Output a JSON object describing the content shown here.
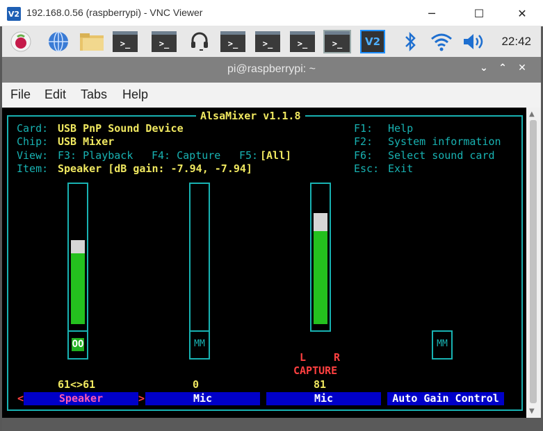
{
  "vnc": {
    "title": "192.168.0.56 (raspberrypi) - VNC Viewer",
    "logo": "V2",
    "minimize": "─",
    "maximize": "☐",
    "close": "✕"
  },
  "panel": {
    "clock": "22:42",
    "term_prompt": ">_",
    "vnc_icon": "V2",
    "icons": [
      "raspberry-menu-icon",
      "web-browser-icon",
      "file-manager-icon",
      "terminal-icon",
      "terminal-icon",
      "headset-icon",
      "terminal-icon",
      "terminal-icon",
      "terminal-icon",
      "terminal-icon",
      "vnc-server-icon",
      "bluetooth-icon",
      "wifi-icon",
      "volume-icon"
    ]
  },
  "terminal": {
    "title": "pi@raspberrypi: ~",
    "menu": [
      "File",
      "Edit",
      "Tabs",
      "Help"
    ],
    "btn_min": "⌄",
    "btn_max": "⌃",
    "btn_close": "✕"
  },
  "alsamixer": {
    "title": "AlsaMixer v1.1.8",
    "card_label": "Card:",
    "card_value": "USB PnP Sound Device",
    "chip_label": "Chip:",
    "chip_value": "USB Mixer",
    "view_label": "View:",
    "view_f3": "F3: Playback",
    "view_f4": "F4: Capture",
    "view_f5": "F5:",
    "view_all": "[All]",
    "item_label": "Item:",
    "item_value": "Speaker [dB gain: -7.94, -7.94]",
    "help_keys": [
      "F1:",
      "F2:",
      "F6:",
      "Esc:"
    ],
    "help_texts": [
      "Help",
      "System information",
      "Select sound card",
      "Exit"
    ],
    "controls": [
      {
        "name": "Speaker",
        "value_text": "61<>61",
        "switch": "OO",
        "level": 0.61,
        "selected": true
      },
      {
        "name": "Mic",
        "value_text": "0",
        "switch": "MM",
        "level": 0
      },
      {
        "name": "Mic",
        "value_text": "81",
        "capture": "CAPTURE",
        "capture_l": "L",
        "capture_r": "R",
        "level": 0.81
      },
      {
        "name": "Auto Gain Control",
        "switch": "MM"
      }
    ],
    "select_left": "<",
    "select_right": ">"
  },
  "colors": {
    "teal": "#18b2b2",
    "yellow": "#f0e860",
    "green": "#24c11e",
    "blue_label": "#0000c8",
    "selected_label": "#ff5ab0"
  }
}
